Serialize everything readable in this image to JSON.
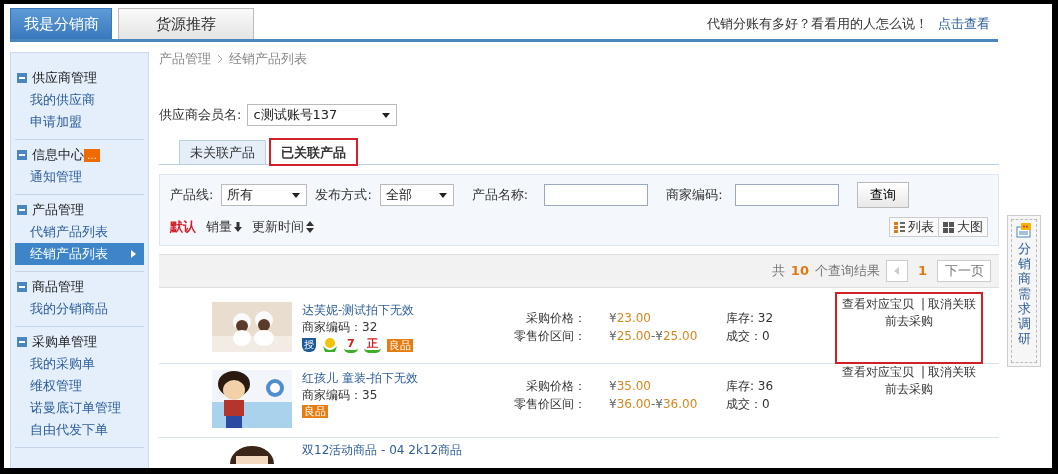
{
  "top_tabs": [
    {
      "label": "我是分销商",
      "selected": true
    },
    {
      "label": "货源推荐",
      "selected": false
    }
  ],
  "promo": {
    "text": "代销分账有多好？看看用的人怎么说！",
    "link": "点击查看"
  },
  "sidebar": {
    "groups": [
      {
        "title": "供应商管理",
        "items": [
          {
            "label": "我的供应商",
            "selected": false
          },
          {
            "label": "申请加盟",
            "selected": false
          }
        ]
      },
      {
        "title": "信息中心",
        "badge": "…",
        "items": [
          {
            "label": "通知管理",
            "selected": false
          }
        ]
      },
      {
        "title": "产品管理",
        "items": [
          {
            "label": "代销产品列表",
            "selected": false
          },
          {
            "label": "经销产品列表",
            "selected": true
          }
        ]
      },
      {
        "title": "商品管理",
        "items": [
          {
            "label": "我的分销商品",
            "selected": false
          }
        ]
      },
      {
        "title": "采购单管理",
        "items": [
          {
            "label": "我的采购单",
            "selected": false
          },
          {
            "label": "维权管理",
            "selected": false
          },
          {
            "label": "诺曼底订单管理",
            "selected": false
          },
          {
            "label": "自由代发下单",
            "selected": false
          }
        ]
      }
    ]
  },
  "breadcrumb": [
    "产品管理",
    "经销产品列表"
  ],
  "supplier": {
    "label": "供应商会员名:",
    "value": "c测试账号137"
  },
  "tabs": [
    {
      "label": "未关联产品",
      "selected": false,
      "highlighted": false
    },
    {
      "label": "已关联产品",
      "selected": true,
      "highlighted": true
    }
  ],
  "filters": {
    "product_line": {
      "label": "产品线:",
      "value": "所有"
    },
    "publish": {
      "label": "发布方式:",
      "value": "全部"
    },
    "name": {
      "label": "产品名称:"
    },
    "code": {
      "label": "商家编码:"
    },
    "search_button": "查询"
  },
  "sort": [
    {
      "label": "默认",
      "selected": true,
      "kind": "plain"
    },
    {
      "label": "销量",
      "selected": false,
      "kind": "down"
    },
    {
      "label": "更新时间",
      "selected": false,
      "kind": "both"
    }
  ],
  "views": [
    {
      "label": "列表",
      "kind": "list"
    },
    {
      "label": "大图",
      "kind": "grid"
    }
  ],
  "results": {
    "prefix": "共",
    "count": "10",
    "suffix": "个查询结果",
    "page": "1",
    "next": "下一页"
  },
  "rows": [
    {
      "kind": "dolls",
      "title": "达芙妮-测试拍下无效",
      "code": "商家编码：32",
      "badges": [
        {
          "kind": "shield",
          "text": "授"
        },
        {
          "kind": "hands-bulb"
        },
        {
          "kind": "hands",
          "text": "7"
        },
        {
          "kind": "hands",
          "text": "正"
        },
        {
          "kind": "tag",
          "text": "良品"
        }
      ],
      "purchase_label": "采购价格：",
      "purchase": {
        "symbol": "¥",
        "amount": "23.00"
      },
      "retail_label": "零售价区间：",
      "retail": [
        {
          "symbol": "¥",
          "amount": "25.00"
        },
        {
          "symbol": "-¥",
          "amount": "25.00"
        }
      ],
      "stock": "库存: 32",
      "deals": "成交：0",
      "actions": {
        "view": "查看对应宝贝",
        "sep": "|",
        "unlink": "取消关联",
        "buy": "前去采购"
      },
      "highlighted": true
    },
    {
      "kind": "cartoon",
      "title": "红孩儿 童装-拍下无效",
      "code": "商家编码：35",
      "badges": [
        {
          "kind": "tag",
          "text": "良品"
        }
      ],
      "purchase_label": "采购价格：",
      "purchase": {
        "symbol": "¥",
        "amount": "35.00"
      },
      "retail_label": "零售价区间：",
      "retail": [
        {
          "symbol": "¥",
          "amount": "36.00"
        },
        {
          "symbol": "-¥",
          "amount": "36.00"
        }
      ],
      "stock": "库存: 36",
      "deals": "成交：0",
      "actions": {
        "view": "查看对应宝贝",
        "sep": "|",
        "unlink": "取消关联",
        "buy": "前去采购"
      },
      "highlighted": false
    },
    {
      "kind": "partial",
      "title": "双12活动商品 - 04 2k12商品"
    }
  ],
  "survey": "分销商需求调研"
}
